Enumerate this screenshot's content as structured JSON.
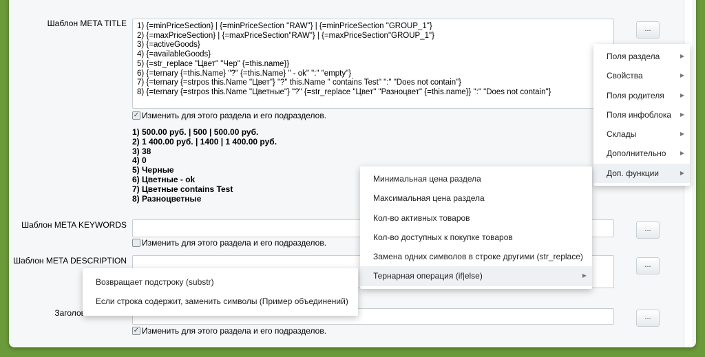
{
  "fields": {
    "title_label": "Шаблон META TITLE",
    "title_lines": [
      "1) {=minPriceSection} | {=minPriceSection \"RAW\"} | {=minPriceSection \"GROUP_1\"}",
      "2) {=maxPriceSection} | {=maxPriceSection\"RAW\"} | {=maxPriceSection\"GROUP_1\"}",
      "3) {=activeGoods}",
      "4) {=availableGoods}",
      "5) {=str_replace \"Цвет\" \"Чер\" {=this.name}}",
      "6) {=ternary {=this.Name} \"?\" {=this.Name} \" - ok\" \":\" \"empty\"}",
      "7) {=ternary {=strpos this.Name \"Цвет\"} \"?\" this.Name \" contains Test\" \":\" \"Does not contain\"}",
      "8) {=ternary {=strpos this.Name \"Цветные\"} \"?\" {=str_replace \"Цвет\" \"Разноцвет\" {=this.name}} \":\" \"Does not contain\"}"
    ],
    "checkbox_label": "Изменить для этого раздела и его подразделов.",
    "results": [
      "1) 500.00 руб. | 500 | 500.00 руб.",
      "2) 1 400.00 руб. | 1400 | 1 400.00 руб.",
      "3) 38",
      "4) 0",
      "5) Черные",
      "6) Цветные - ok",
      "7) Цветные contains Test",
      "8) Разноцветные"
    ],
    "keywords_label": "Шаблон META KEYWORDS",
    "description_label": "Шаблон META DESCRIPTION",
    "heading_label": "Заголов",
    "button_label": "..."
  },
  "checkbox_states": {
    "title": true,
    "keywords": false,
    "heading": true
  },
  "menu1": [
    "Поля раздела",
    "Свойства",
    "Поля родителя",
    "Поля инфоблока",
    "Склады",
    "Дополнительно",
    "Доп. функции"
  ],
  "menu2": [
    "Минимальная цена раздела",
    "Максимальная цена раздела",
    "Кол-во активных товаров",
    "Кол-во доступных к покупке товаров",
    "Замена одних символов в строке другими (str_replace)",
    "Тернарная операция (if|else)"
  ],
  "menu3": [
    "Возвращает подстроку (substr)",
    "Если строка содержит, заменить символы (Пример объединений)"
  ]
}
